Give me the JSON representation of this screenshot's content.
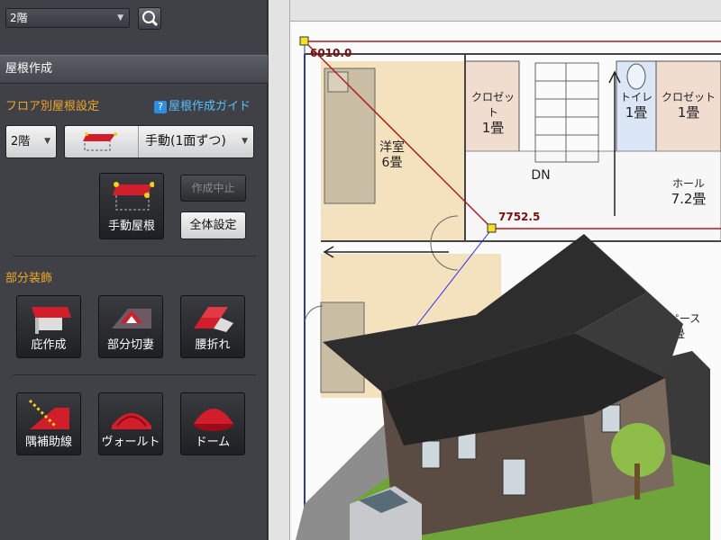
{
  "floor_select": {
    "value": "2階"
  },
  "section": {
    "title": "屋根作成"
  },
  "floor_roof": {
    "heading": "フロア別屋根設定",
    "guide_label": "屋根作成ガイド",
    "floor_value": "2階",
    "mode_value": "手動(1面ずつ)",
    "manual_roof_label": "手動屋根",
    "cancel_label": "作成中止",
    "overall_label": "全体設定"
  },
  "partial": {
    "heading": "部分装飾",
    "tools": [
      {
        "label": "庇作成"
      },
      {
        "label": "部分切妻"
      },
      {
        "label": "腰折れ"
      },
      {
        "label": "隅補助線"
      },
      {
        "label": "ヴォールト"
      },
      {
        "label": "ドーム"
      }
    ]
  },
  "plan": {
    "dim1": "6010.0",
    "dim2": "7752.5",
    "rooms": {
      "closet1_name": "クロゼット",
      "closet1_size": "1畳",
      "toilet_name": "トイレ",
      "toilet_size": "1畳",
      "closet2_name": "クロゼット",
      "closet2_size": "1畳",
      "western_name": "洋室",
      "western_size": "6畳",
      "dn": "DN",
      "hall_name": "ホール",
      "hall_size": "7.2畳",
      "space_name": "スペース",
      "space_size": "畳"
    }
  },
  "colors": {
    "accent_orange": "#f2a627",
    "link_blue": "#56c2ff",
    "roof_red": "#c8102e",
    "outline_red": "#b01a1a"
  }
}
